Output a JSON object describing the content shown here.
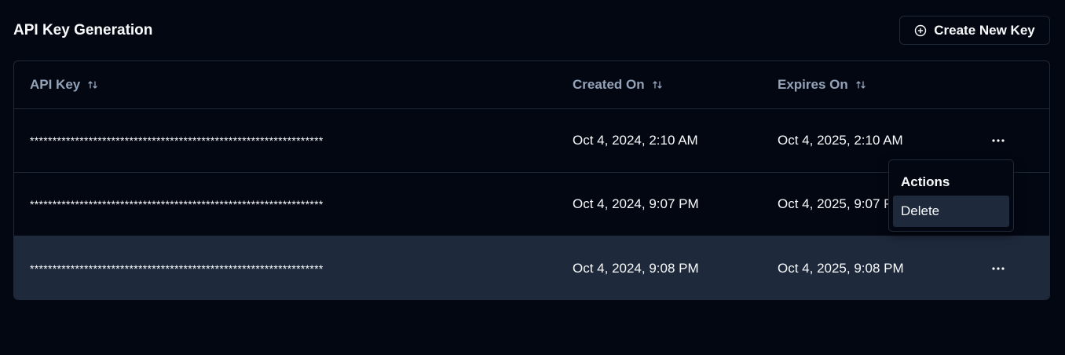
{
  "header": {
    "title": "API Key Generation",
    "create_button_label": "Create New Key"
  },
  "table": {
    "columns": [
      "API Key",
      "Created On",
      "Expires On"
    ],
    "rows": [
      {
        "api_key": "*****************************************************************",
        "created_on": "Oct 4, 2024, 2:10 AM",
        "expires_on": "Oct 4, 2025, 2:10 AM"
      },
      {
        "api_key": "*****************************************************************",
        "created_on": "Oct 4, 2024, 9:07 PM",
        "expires_on": "Oct 4, 2025, 9:07 PM"
      },
      {
        "api_key": "*****************************************************************",
        "created_on": "Oct 4, 2024, 9:08 PM",
        "expires_on": "Oct 4, 2025, 9:08 PM"
      }
    ]
  },
  "actions_menu": {
    "title": "Actions",
    "items": [
      "Delete"
    ]
  },
  "colors": {
    "background": "#030712",
    "border": "#1f2937",
    "highlight_row": "#1e293b",
    "header_text": "#94a3b8",
    "text": "#f8fafc"
  },
  "icons": {
    "create": "plus-circle-icon",
    "sort": "sort-arrows-icon",
    "row_actions": "ellipsis-icon"
  }
}
